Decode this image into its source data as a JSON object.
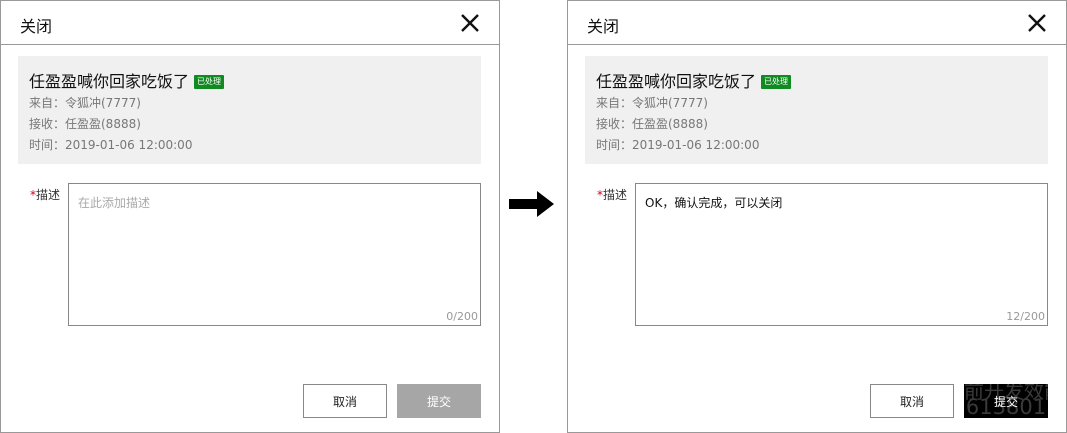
{
  "dialog_left": {
    "title": "关闭",
    "message": {
      "title": "任盈盈喊你回家吃饭了",
      "badge": "已处理",
      "from": "来自：令狐冲(7777)",
      "to": "接收：任盈盈(8888)",
      "time": "时间：2019-01-06 12:00:00"
    },
    "description": {
      "required_mark": "*",
      "label": "描述",
      "placeholder": "在此添加描述",
      "value": "",
      "counter": "0/200"
    },
    "buttons": {
      "cancel": "取消",
      "submit": "提交"
    }
  },
  "dialog_right": {
    "title": "关闭",
    "message": {
      "title": "任盈盈喊你回家吃饭了",
      "badge": "已处理",
      "from": "来自：令狐冲(7777)",
      "to": "接收：任盈盈(8888)",
      "time": "时间：2019-01-06 12:00:00"
    },
    "description": {
      "required_mark": "*",
      "label": "描述",
      "value": "OK，确认完成，可以关闭",
      "counter": "12/200"
    },
    "buttons": {
      "cancel": "取消",
      "submit": "提交",
      "watermark_line1": "前开发效能者",
      "watermark_line2": "613801"
    }
  },
  "arrow_icon": "right-arrow",
  "colors": {
    "badge": "#118a21",
    "info_bg": "#f0f0f0",
    "submit_disabled": "#a6a6a6",
    "submit_active": "#000000",
    "required": "#d0021b"
  }
}
